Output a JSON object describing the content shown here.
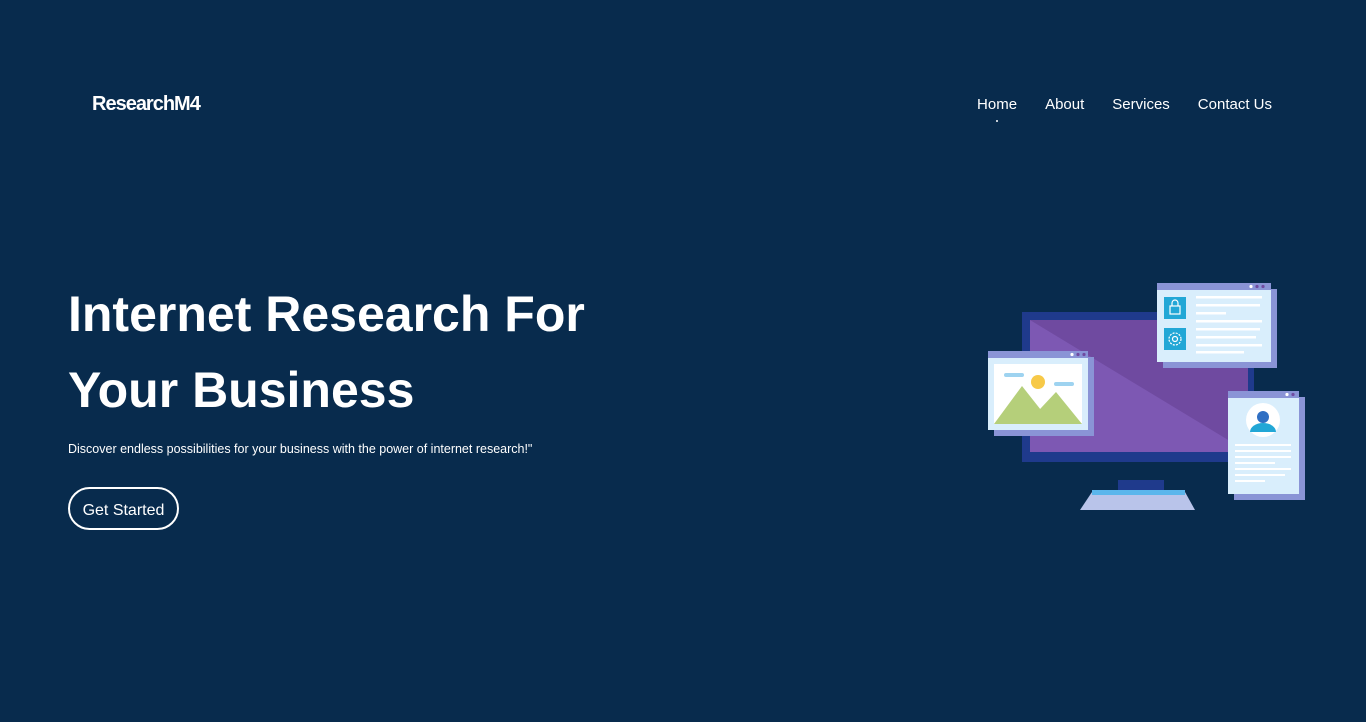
{
  "header": {
    "logo_text": "ResearchM4"
  },
  "nav": {
    "items": [
      {
        "label": "Home",
        "active": true
      },
      {
        "label": "About",
        "active": false
      },
      {
        "label": "Services",
        "active": false
      },
      {
        "label": "Contact Us",
        "active": false
      }
    ]
  },
  "hero": {
    "title": "Internet Research For Your Business",
    "subtitle": "Discover endless possibilities for your business with the power of internet research!\"",
    "cta_label": "Get Started"
  },
  "illustration": {
    "icons": [
      "monitor-icon",
      "image-window-icon",
      "document-window-icon",
      "profile-window-icon",
      "lock-icon",
      "gear-icon"
    ]
  },
  "colors": {
    "background": "#082b4d",
    "text": "#ffffff",
    "monitor_frame": "#1f3a8c",
    "monitor_screen": "#6f4aa0",
    "window_body": "#d9eefc",
    "window_bar": "#8a94d6",
    "accent_teal": "#22a7d6"
  }
}
